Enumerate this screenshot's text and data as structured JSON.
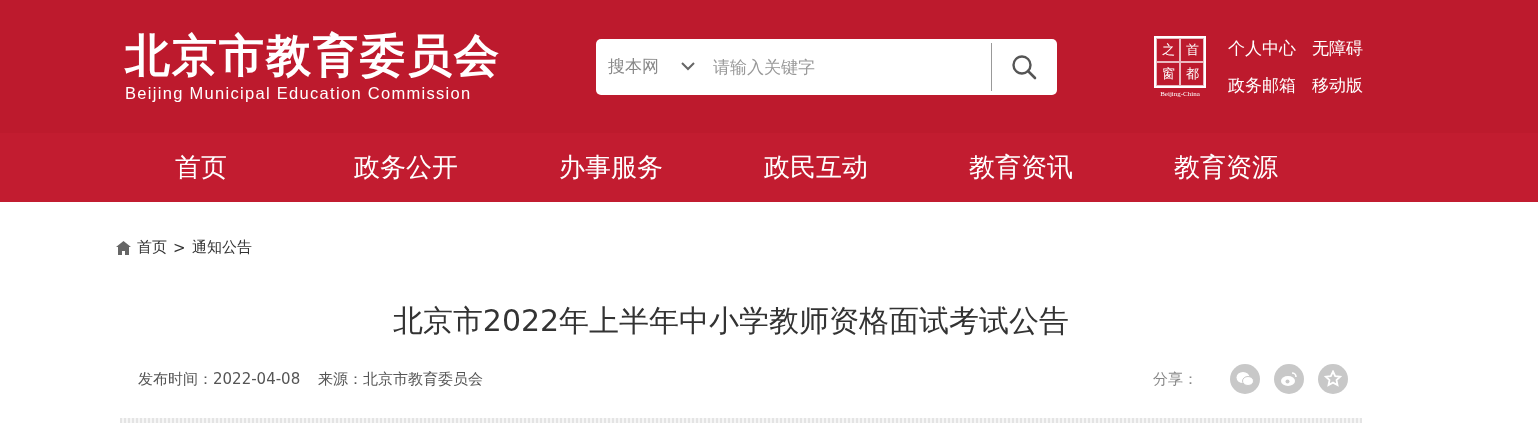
{
  "header": {
    "logo": {
      "title": "北京市教育委员会",
      "subtitle": "Beijing Municipal Education Commission"
    },
    "search": {
      "scope": "搜本网",
      "placeholder": "请输入关键字"
    },
    "emblem": {
      "chars": [
        "之",
        "首",
        "窗",
        "都"
      ],
      "caption": "Beijing-China"
    },
    "links": [
      "个人中心",
      "无障碍",
      "政务邮箱",
      "移动版"
    ]
  },
  "nav": [
    {
      "label": "首页",
      "selected": false
    },
    {
      "label": "政务公开",
      "selected": false
    },
    {
      "label": "办事服务",
      "selected": false
    },
    {
      "label": "政民互动",
      "selected": false
    },
    {
      "label": "教育资讯",
      "selected": false
    },
    {
      "label": "教育资源",
      "selected": false
    }
  ],
  "breadcrumb": [
    "首页",
    ">",
    "通知公告"
  ],
  "article": {
    "title": "北京市2022年上半年中小学教师资格面试考试公告",
    "published": "发布时间：2022-04-08",
    "source": "来源：北京市教育委员会",
    "share_label": "分享："
  }
}
